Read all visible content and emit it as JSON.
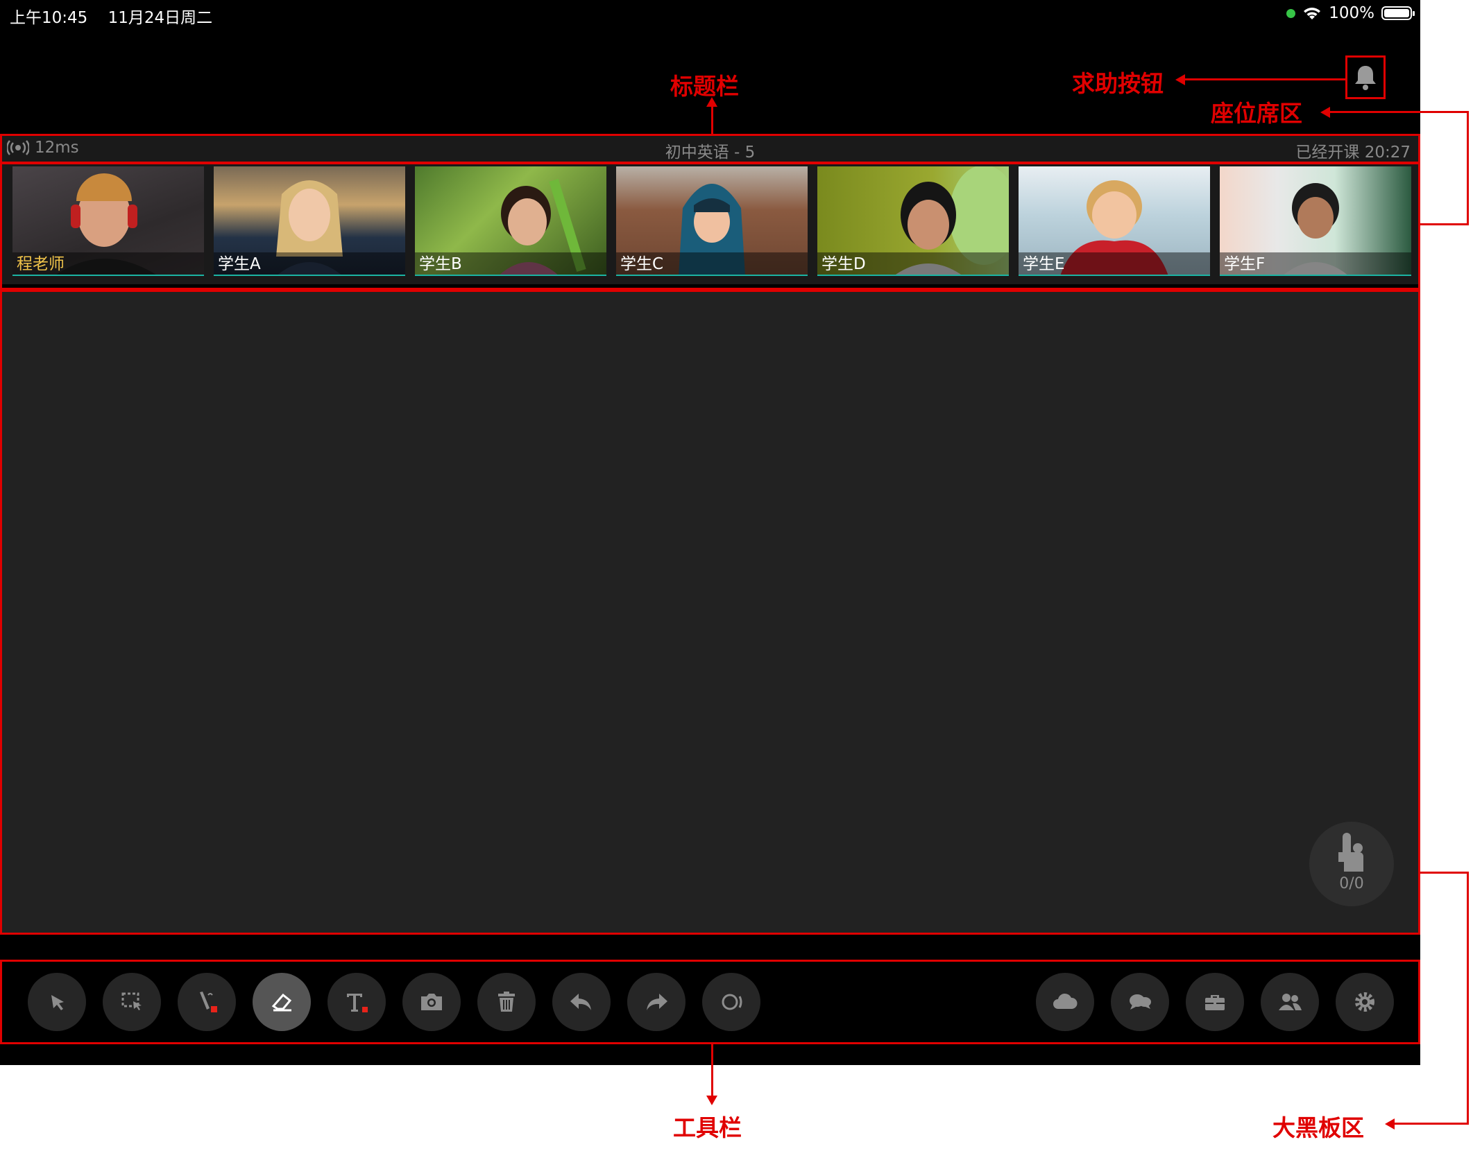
{
  "status_bar": {
    "time": "上午10:45",
    "date": "11月24日周二",
    "battery": "100%"
  },
  "title_bar": {
    "latency": "12ms",
    "course_title": "初中英语 - 5",
    "elapsed_label": "已经开课",
    "elapsed_time": "20:27"
  },
  "seats": [
    {
      "name": "程老师",
      "role": "teacher"
    },
    {
      "name": "学生A"
    },
    {
      "name": "学生B"
    },
    {
      "name": "学生C"
    },
    {
      "name": "学生D"
    },
    {
      "name": "学生E"
    },
    {
      "name": "学生F"
    }
  ],
  "board": {
    "hand_raise_count": "0/0"
  },
  "toolbar": {
    "left_tools": [
      "pointer-icon",
      "box-select-icon",
      "pen-icon",
      "eraser-icon",
      "text-icon",
      "camera-icon",
      "trash-icon",
      "undo-icon",
      "redo-icon",
      "record-icon"
    ],
    "right_tools": [
      "cloud-icon",
      "chat-icon",
      "toolbox-icon",
      "users-icon",
      "settings-icon"
    ],
    "active": "eraser-icon",
    "accent": "#e8231a"
  },
  "annotations": {
    "title_bar": "标题栏",
    "help_button": "求助按钮",
    "seat_area": "座位席区",
    "toolbar": "工具栏",
    "board_area": "大黑板区"
  },
  "colors": {
    "annotation": "#e00000",
    "teacher_name": "#f0c34a",
    "seat_line": "#1bb4a3"
  }
}
